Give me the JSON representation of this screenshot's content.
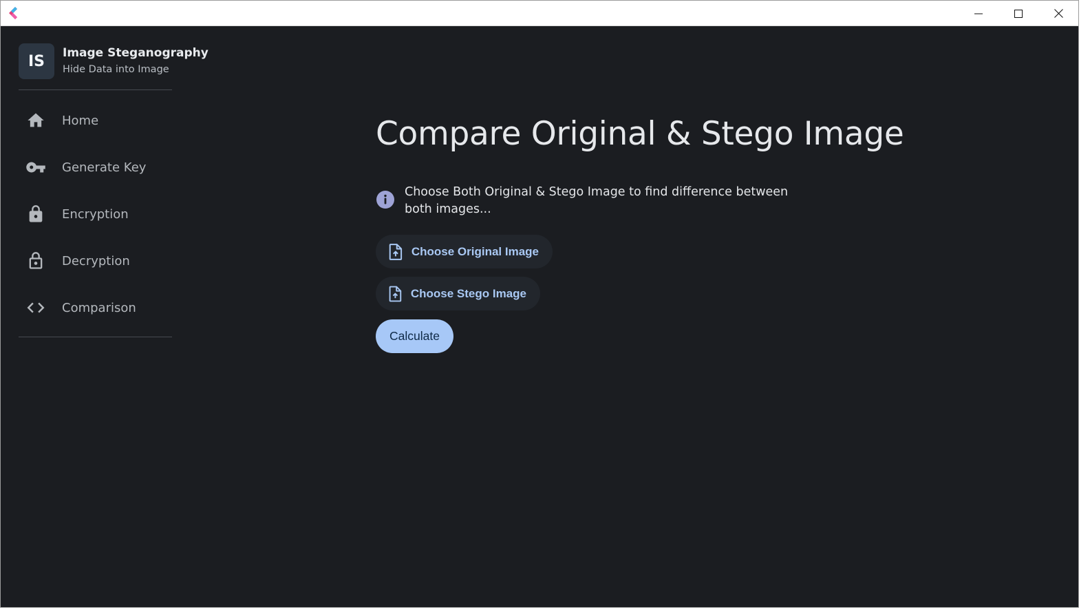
{
  "window": {
    "controls": {
      "minimize": "minimize",
      "maximize": "maximize",
      "close": "close"
    }
  },
  "brand": {
    "initials": "IS",
    "title": "Image Steganography",
    "subtitle": "Hide Data into Image"
  },
  "sidebar": {
    "items": [
      {
        "label": "Home",
        "icon": "home-icon"
      },
      {
        "label": "Generate Key",
        "icon": "key-icon"
      },
      {
        "label": "Encryption",
        "icon": "lock-icon"
      },
      {
        "label": "Decryption",
        "icon": "lock-open-icon"
      },
      {
        "label": "Comparison",
        "icon": "code-icon"
      }
    ]
  },
  "main": {
    "title": "Compare Original & Stego Image",
    "info": "Choose Both Original & Stego Image to find difference between both images...",
    "choose_original_label": "Choose Original Image",
    "choose_stego_label": "Choose Stego Image",
    "calculate_label": "Calculate"
  },
  "colors": {
    "background": "#1b1d21",
    "accent": "#a7c8f7",
    "button_text": "#a9c8f3",
    "info_icon": "#9ea3d6"
  }
}
